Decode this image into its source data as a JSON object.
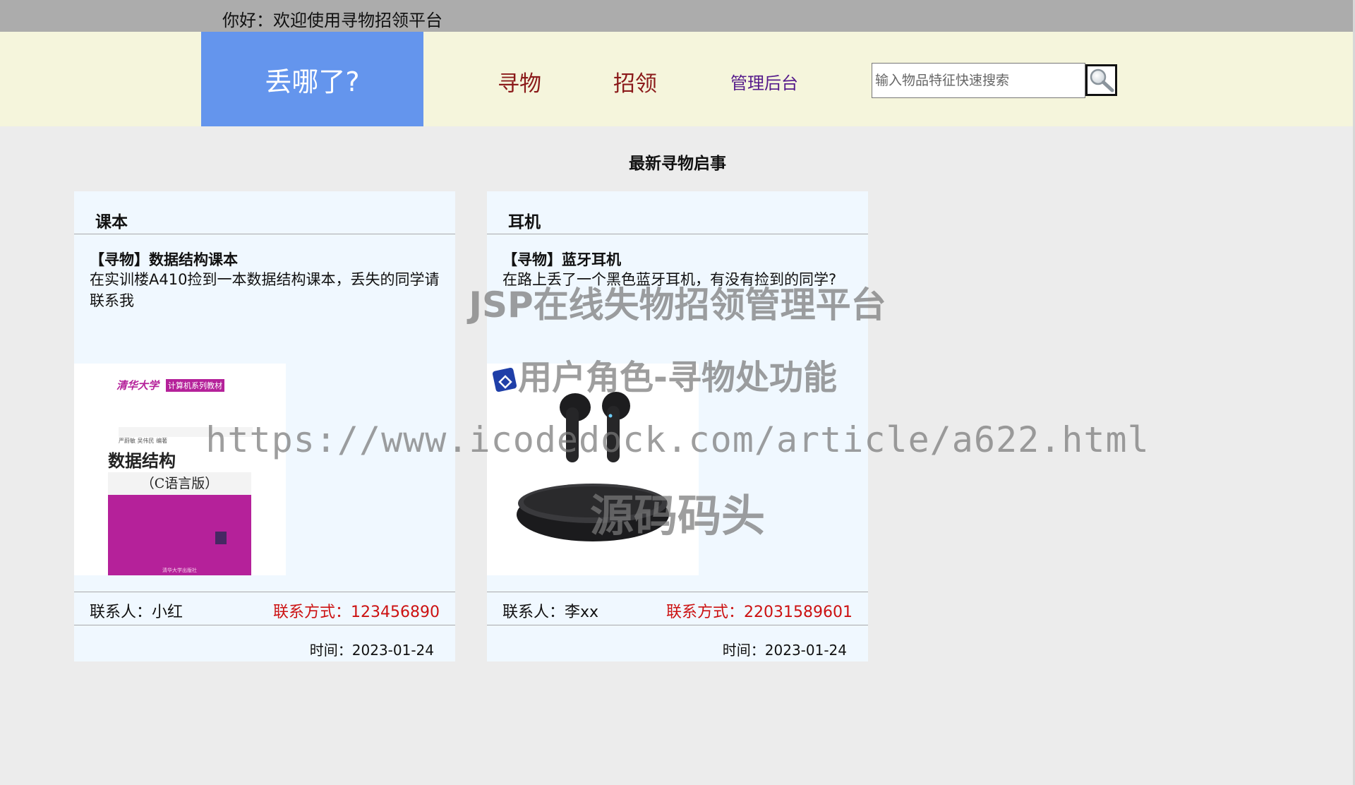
{
  "topbar": {
    "greeting": "你好：欢迎使用寻物招领平台"
  },
  "header": {
    "logo": "丢哪了?",
    "nav": {
      "find": "寻物",
      "claim": "招领",
      "admin": "管理后台"
    },
    "search": {
      "placeholder": "输入物品特征快速搜索",
      "value": ""
    }
  },
  "section": {
    "title": "最新寻物启事"
  },
  "cards": [
    {
      "category": "课本",
      "title": "【寻物】数据结构课本",
      "desc": "在实训楼A410捡到一本数据结构课本，丢失的同学请联系我",
      "contact_name": "联系人：小红",
      "contact_phone": "联系方式：123456890",
      "time": "时间：2023-01-24",
      "image": {
        "univ": "清华大学",
        "series": "计算机系列教材",
        "authors": "严蔚敏 吴伟民 编著",
        "book_title": "数据结构",
        "edition": "（C语言版）",
        "publisher": "清华大学出版社"
      }
    },
    {
      "category": "耳机",
      "title": "【寻物】蓝牙耳机",
      "desc": "在路上丢了一个黑色蓝牙耳机，有没有捡到的同学?",
      "contact_name": "联系人：李xx",
      "contact_phone": "联系方式：22031589601",
      "time": "时间：2023-01-24"
    }
  ],
  "watermark": {
    "line1": "JSP在线失物招领管理平台",
    "line2": "用户角色-寻物处功能",
    "line3": "https://www.icodedock.com/article/a622.html",
    "line4": "源码码头"
  },
  "colors": {
    "topbar": "#acacac",
    "header_bg": "#f5f5dc",
    "logo_bg": "#6495ed",
    "nav_link": "#8b1a1a",
    "admin_link": "#551a8b",
    "card_bg": "#f0f8ff",
    "phone": "#cc1111",
    "book_cover": "#b5219a"
  }
}
